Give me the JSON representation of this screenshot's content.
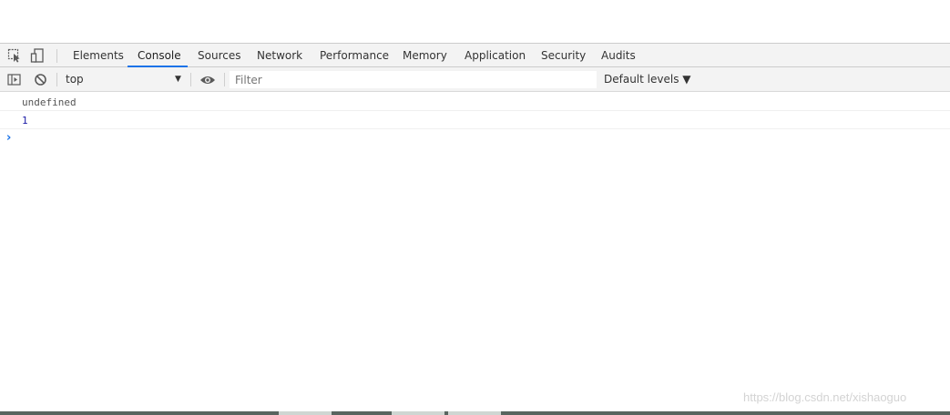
{
  "devtools": {
    "toolbar_icons": [
      "inspect-element-icon",
      "device-toggle-icon"
    ],
    "tabs": [
      {
        "label": "Elements"
      },
      {
        "label": "Console"
      },
      {
        "label": "Sources"
      },
      {
        "label": "Network"
      },
      {
        "label": "Performance"
      },
      {
        "label": "Memory"
      },
      {
        "label": "Application"
      },
      {
        "label": "Security"
      },
      {
        "label": "Audits"
      }
    ],
    "active_tab": "Console",
    "accent_color": "#1a73e8"
  },
  "console_toolbar": {
    "sidebar_icon": "show-console-sidebar-icon",
    "clear_icon": "clear-console-icon",
    "context_value": "top",
    "eye_icon": "live-expression-eye-icon",
    "filter_placeholder": "Filter",
    "levels_label": "Default levels ▼"
  },
  "console": {
    "messages": [
      {
        "text": "undefined"
      },
      {
        "text": "1"
      }
    ],
    "prompt_icon": "prompt-chevron-icon"
  },
  "watermark": "https://blog.csdn.net/xishaoguo"
}
